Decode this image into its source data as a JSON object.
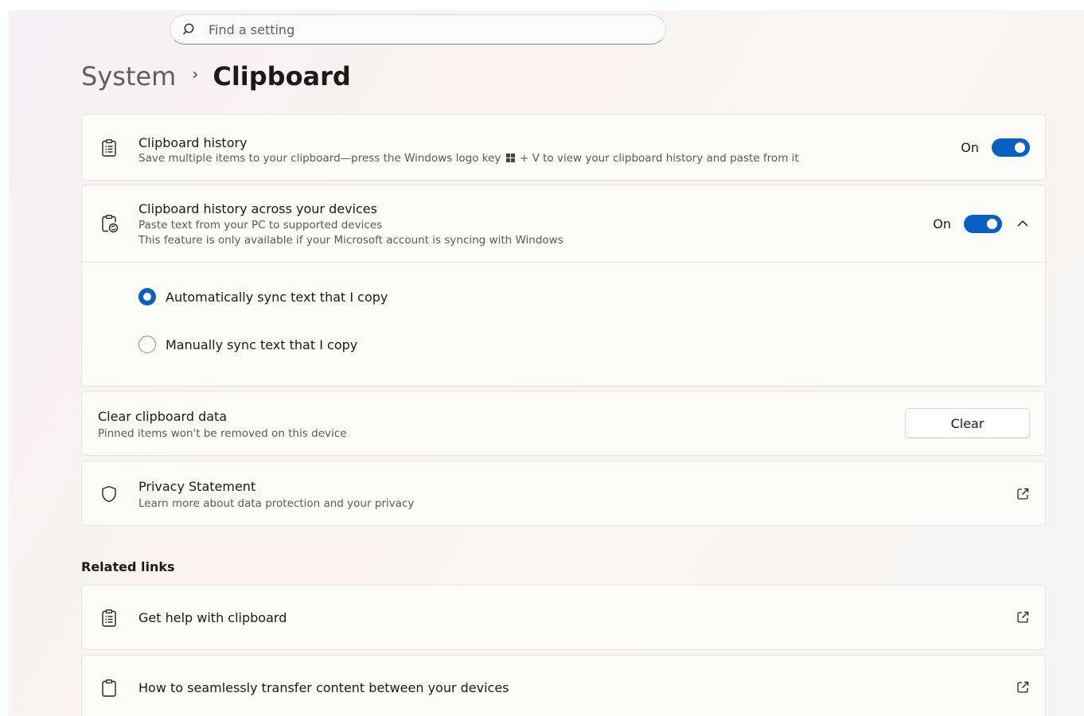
{
  "search": {
    "placeholder": "Find a setting"
  },
  "breadcrumb": {
    "parent": "System",
    "separator": "›",
    "current": "Clipboard"
  },
  "clipboard_history": {
    "title": "Clipboard history",
    "description_before": "Save multiple items to your clipboard—press the Windows logo key",
    "description_after": "+ V to view your clipboard history and paste from it",
    "toggle_label": "On",
    "toggle_state": true
  },
  "sync_devices": {
    "title": "Clipboard history across your devices",
    "description_line1": "Paste text from your PC to supported devices",
    "description_line2": "This feature is only available if your Microsoft account is syncing with Windows",
    "toggle_label": "On",
    "toggle_state": true,
    "expanded": true,
    "options": [
      {
        "label": "Automatically sync text that I copy",
        "selected": true
      },
      {
        "label": "Manually sync text that I copy",
        "selected": false
      }
    ]
  },
  "clear_data": {
    "title": "Clear clipboard data",
    "description": "Pinned items won't be removed on this device",
    "button_label": "Clear"
  },
  "privacy": {
    "title": "Privacy Statement",
    "description": "Learn more about data protection and your privacy"
  },
  "related_links": {
    "heading": "Related links",
    "items": [
      {
        "label": "Get help with clipboard"
      },
      {
        "label": "How to seamlessly transfer content between your devices"
      }
    ]
  },
  "colors": {
    "accent": "#0a5fc2",
    "card_bg": "#fbfbfa",
    "border": "#e6e3e3"
  },
  "icons": [
    "search-icon",
    "clipboard-list-icon",
    "clipboard-sync-icon",
    "chevron-up-icon",
    "shield-icon",
    "external-link-icon",
    "clipboard-icon",
    "windows-logo-icon"
  ]
}
